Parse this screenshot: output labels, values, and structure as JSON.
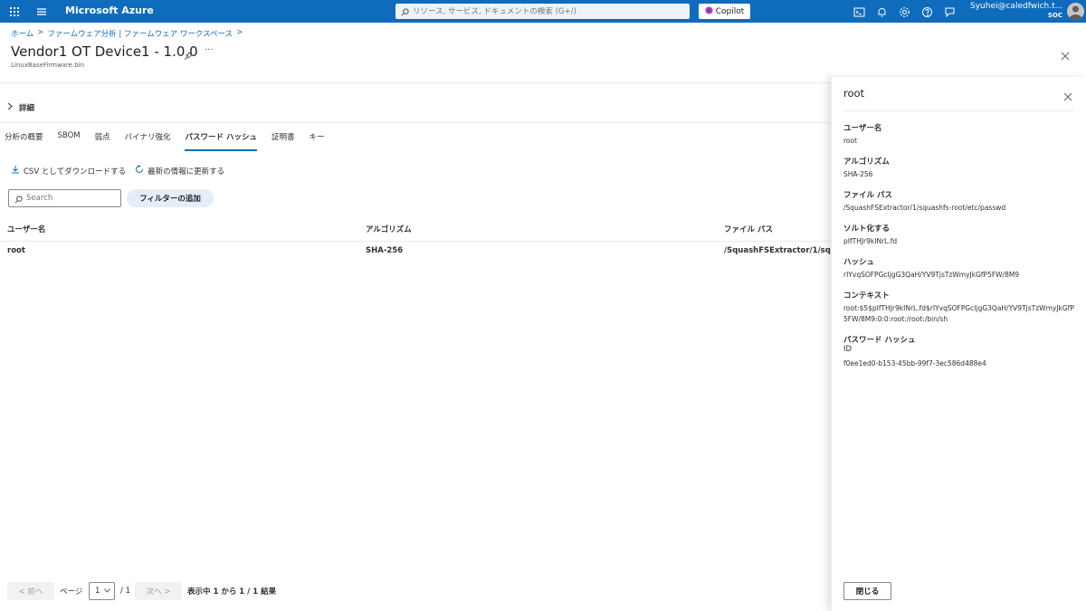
{
  "topbar": {
    "brand": "Microsoft Azure",
    "search_placeholder": "リソース, サービス, ドキュメントの検索 (G+/)",
    "copilot_label": "Copilot",
    "user_name": "Syuhei@caledfwich.t...",
    "user_org": "SOC",
    "accent": "#0f6cbd"
  },
  "breadcrumb": {
    "home": "ホーム",
    "workspace": "ファームウェア分析 | ファームウェア ワークスペース"
  },
  "page": {
    "title": "Vendor1 OT Device1 - 1.0.0",
    "subtitle": "LinuxBaseFirmware.bin",
    "details_label": "詳細"
  },
  "tabs": [
    {
      "label": "分析の概要"
    },
    {
      "label": "SBOM"
    },
    {
      "label": "弱点"
    },
    {
      "label": "バイナリ強化"
    },
    {
      "label": "パスワード ハッシュ"
    },
    {
      "label": "証明書"
    },
    {
      "label": "キー"
    }
  ],
  "actions": {
    "download": "CSV としてダウンロードする",
    "refresh": "最新の情報に更新する",
    "search_placeholder": "Search",
    "filter": "フィルターの追加"
  },
  "table": {
    "headers": [
      "ユーザー名",
      "アルゴリズム",
      "ファイル パス"
    ],
    "rows": [
      [
        "root",
        "SHA-256",
        "/SquashFSExtractor/1/squash"
      ]
    ]
  },
  "pager": {
    "prev": "< 前へ",
    "page_label": "ページ",
    "page_value": "1",
    "total": "/ 1",
    "next": "次へ >",
    "summary": "表示中 1 から 1 / 1 結果"
  },
  "panel": {
    "title": "root",
    "fields": [
      {
        "label": "ユーザー名",
        "value": "root"
      },
      {
        "label": "アルゴリズム",
        "value": "SHA-256"
      },
      {
        "label": "ファイル パス",
        "value": "/SquashFSExtractor/1/squashfs-root/etc/passwd"
      },
      {
        "label": "ソルト化する",
        "value": "pIfTHJr9kINrL.fd"
      },
      {
        "label": "ハッシュ",
        "value": "rIYvqSOFPGcIjgG3QaH/YV9TjsTzWmyJkGfP5FW/8M9"
      },
      {
        "label": "コンテキスト",
        "value": "root:$5$pIfTHJr9kINrL.fd$rIYvqSOFPGcIjgG3QaH/YV9TjsTzWmyJkGfP5FW/8M9:0:0:root:/root:/bin/sh"
      },
      {
        "label": "パスワード ハッシュ",
        "label2": "ID",
        "value": "f0ee1ed0-b153-45bb-99f7-3ec586d488e4"
      }
    ],
    "close_label": "閉じる"
  }
}
